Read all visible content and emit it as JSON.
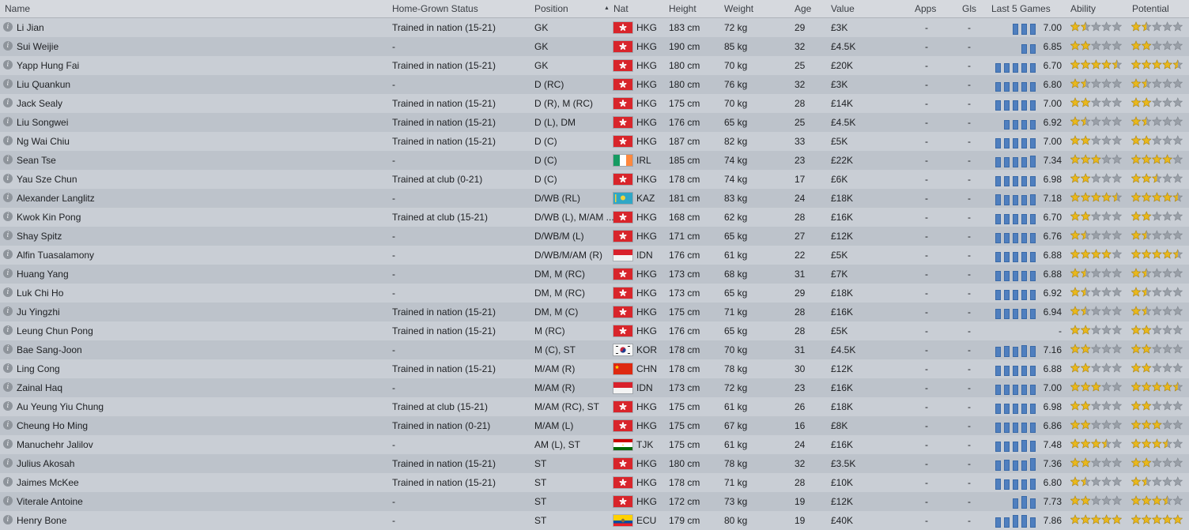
{
  "headers": {
    "name": "Name",
    "hgs": "Home-Grown Status",
    "position": "Position",
    "nat": "Nat",
    "height": "Height",
    "weight": "Weight",
    "age": "Age",
    "value": "Value",
    "apps": "Apps",
    "gls": "Gls",
    "last5": "Last 5 Games",
    "ability": "Ability",
    "potential": "Potential"
  },
  "colors": {
    "bar": "#4f7fbf",
    "star_gold": "#e9b81c",
    "star_empty": "#9aa0a8"
  },
  "players": [
    {
      "name": "Li Jian",
      "hgs": "Trained in nation (15-21)",
      "pos": "GK",
      "flag": "hkg",
      "nat": "HKG",
      "height": "183 cm",
      "weight": "72 kg",
      "age": "29",
      "value": "£3K",
      "apps": "-",
      "gls": "-",
      "last5": [
        0,
        0,
        14,
        14,
        14
      ],
      "rating": "7.00",
      "ability": 1.5,
      "potential": 1.5
    },
    {
      "name": "Sui Weijie",
      "hgs": "-",
      "pos": "GK",
      "flag": "hkg",
      "nat": "HKG",
      "height": "190 cm",
      "weight": "85 kg",
      "age": "32",
      "value": "£4.5K",
      "apps": "-",
      "gls": "-",
      "last5": [
        0,
        0,
        0,
        12,
        12
      ],
      "rating": "6.85",
      "ability": 2,
      "potential": 2
    },
    {
      "name": "Yapp Hung Fai",
      "hgs": "Trained in nation (15-21)",
      "pos": "GK",
      "flag": "hkg",
      "nat": "HKG",
      "height": "180 cm",
      "weight": "70 kg",
      "age": "25",
      "value": "£20K",
      "apps": "-",
      "gls": "-",
      "last5": [
        12,
        12,
        12,
        12,
        12
      ],
      "rating": "6.70",
      "ability": 4.5,
      "potential": 4.5
    },
    {
      "name": "Liu Quankun",
      "hgs": "-",
      "pos": "D (RC)",
      "flag": "hkg",
      "nat": "HKG",
      "height": "180 cm",
      "weight": "76 kg",
      "age": "32",
      "value": "£3K",
      "apps": "-",
      "gls": "-",
      "last5": [
        12,
        12,
        12,
        12,
        12
      ],
      "rating": "6.80",
      "ability": 1.5,
      "potential": 1.5
    },
    {
      "name": "Jack Sealy",
      "hgs": "Trained in nation (15-21)",
      "pos": "D (R), M (RC)",
      "flag": "hkg",
      "nat": "HKG",
      "height": "175 cm",
      "weight": "70 kg",
      "age": "28",
      "value": "£14K",
      "apps": "-",
      "gls": "-",
      "last5": [
        13,
        13,
        13,
        13,
        13
      ],
      "rating": "7.00",
      "ability": 2,
      "potential": 2
    },
    {
      "name": "Liu Songwei",
      "hgs": "Trained in nation (15-21)",
      "pos": "D (L), DM",
      "flag": "hkg",
      "nat": "HKG",
      "height": "176 cm",
      "weight": "65 kg",
      "age": "25",
      "value": "£4.5K",
      "apps": "-",
      "gls": "-",
      "last5": [
        0,
        12,
        12,
        12,
        12
      ],
      "rating": "6.92",
      "ability": 1.5,
      "potential": 1.5
    },
    {
      "name": "Ng Wai Chiu",
      "hgs": "Trained in nation (15-21)",
      "pos": "D (C)",
      "flag": "hkg",
      "nat": "HKG",
      "height": "187 cm",
      "weight": "82 kg",
      "age": "33",
      "value": "£5K",
      "apps": "-",
      "gls": "-",
      "last5": [
        13,
        13,
        13,
        13,
        13
      ],
      "rating": "7.00",
      "ability": 2,
      "potential": 2
    },
    {
      "name": "Sean Tse",
      "hgs": "-",
      "pos": "D (C)",
      "flag": "irl",
      "nat": "IRL",
      "height": "185 cm",
      "weight": "74 kg",
      "age": "23",
      "value": "£22K",
      "apps": "-",
      "gls": "-",
      "last5": [
        13,
        13,
        13,
        13,
        15
      ],
      "rating": "7.34",
      "ability": 3,
      "potential": 4
    },
    {
      "name": "Yau Sze Chun",
      "hgs": "Trained at club (0-21)",
      "pos": "D (C)",
      "flag": "hkg",
      "nat": "HKG",
      "height": "178 cm",
      "weight": "74 kg",
      "age": "17",
      "value": "£6K",
      "apps": "-",
      "gls": "-",
      "last5": [
        13,
        13,
        13,
        13,
        13
      ],
      "rating": "6.98",
      "ability": 2,
      "potential": 2.5
    },
    {
      "name": "Alexander Langlitz",
      "hgs": "-",
      "pos": "D/WB (RL)",
      "flag": "kaz",
      "nat": "KAZ",
      "height": "181 cm",
      "weight": "83 kg",
      "age": "24",
      "value": "£18K",
      "apps": "-",
      "gls": "-",
      "last5": [
        14,
        13,
        13,
        13,
        14
      ],
      "rating": "7.18",
      "ability": 4.5,
      "potential": 4.5
    },
    {
      "name": "Kwok Kin Pong",
      "hgs": "Trained at club (15-21)",
      "pos": "D/WB (L), M/AM ...",
      "flag": "hkg",
      "nat": "HKG",
      "height": "168 cm",
      "weight": "62 kg",
      "age": "28",
      "value": "£16K",
      "apps": "-",
      "gls": "-",
      "last5": [
        13,
        13,
        13,
        13,
        13
      ],
      "rating": "6.70",
      "ability": 2,
      "potential": 2
    },
    {
      "name": "Shay Spitz",
      "hgs": "-",
      "pos": "D/WB/M (L)",
      "flag": "hkg",
      "nat": "HKG",
      "height": "171 cm",
      "weight": "65 kg",
      "age": "27",
      "value": "£12K",
      "apps": "-",
      "gls": "-",
      "last5": [
        13,
        13,
        13,
        13,
        13
      ],
      "rating": "6.76",
      "ability": 1.5,
      "potential": 1.5
    },
    {
      "name": "Alfin Tuasalamony",
      "hgs": "-",
      "pos": "D/WB/M/AM (R)",
      "flag": "idn",
      "nat": "IDN",
      "height": "176 cm",
      "weight": "61 kg",
      "age": "22",
      "value": "£5K",
      "apps": "-",
      "gls": "-",
      "last5": [
        13,
        13,
        13,
        13,
        13
      ],
      "rating": "6.88",
      "ability": 4,
      "potential": 4.5
    },
    {
      "name": "Huang Yang",
      "hgs": "-",
      "pos": "DM, M (RC)",
      "flag": "hkg",
      "nat": "HKG",
      "height": "173 cm",
      "weight": "68 kg",
      "age": "31",
      "value": "£7K",
      "apps": "-",
      "gls": "-",
      "last5": [
        13,
        13,
        13,
        13,
        13
      ],
      "rating": "6.88",
      "ability": 1.5,
      "potential": 1.5
    },
    {
      "name": "Luk Chi Ho",
      "hgs": "-",
      "pos": "DM, M (RC)",
      "flag": "hkg",
      "nat": "HKG",
      "height": "173 cm",
      "weight": "65 kg",
      "age": "29",
      "value": "£18K",
      "apps": "-",
      "gls": "-",
      "last5": [
        13,
        13,
        13,
        13,
        13
      ],
      "rating": "6.92",
      "ability": 1.5,
      "potential": 1.5
    },
    {
      "name": "Ju Yingzhi",
      "hgs": "Trained in nation (15-21)",
      "pos": "DM, M (C)",
      "flag": "hkg",
      "nat": "HKG",
      "height": "175 cm",
      "weight": "71 kg",
      "age": "28",
      "value": "£16K",
      "apps": "-",
      "gls": "-",
      "last5": [
        13,
        13,
        13,
        13,
        13
      ],
      "rating": "6.94",
      "ability": 1.5,
      "potential": 1.5
    },
    {
      "name": "Leung Chun Pong",
      "hgs": "Trained in nation (15-21)",
      "pos": "M (RC)",
      "flag": "hkg",
      "nat": "HKG",
      "height": "176 cm",
      "weight": "65 kg",
      "age": "28",
      "value": "£5K",
      "apps": "-",
      "gls": "-",
      "last5": [
        0,
        0,
        0,
        0,
        0
      ],
      "rating": "-",
      "ability": 2,
      "potential": 2
    },
    {
      "name": "Bae Sang-Joon",
      "hgs": "-",
      "pos": "M (C), ST",
      "flag": "kor",
      "nat": "KOR",
      "height": "178 cm",
      "weight": "70 kg",
      "age": "31",
      "value": "£4.5K",
      "apps": "-",
      "gls": "-",
      "last5": [
        13,
        14,
        13,
        15,
        14
      ],
      "rating": "7.16",
      "ability": 2,
      "potential": 2
    },
    {
      "name": "Ling Cong",
      "hgs": "Trained in nation (15-21)",
      "pos": "M/AM (R)",
      "flag": "chn",
      "nat": "CHN",
      "height": "178 cm",
      "weight": "78 kg",
      "age": "30",
      "value": "£12K",
      "apps": "-",
      "gls": "-",
      "last5": [
        13,
        13,
        13,
        13,
        13
      ],
      "rating": "6.88",
      "ability": 2,
      "potential": 2
    },
    {
      "name": "Zainal Haq",
      "hgs": "-",
      "pos": "M/AM (R)",
      "flag": "idn",
      "nat": "IDN",
      "height": "173 cm",
      "weight": "72 kg",
      "age": "23",
      "value": "£16K",
      "apps": "-",
      "gls": "-",
      "last5": [
        13,
        13,
        13,
        13,
        13
      ],
      "rating": "7.00",
      "ability": 3,
      "potential": 4.5
    },
    {
      "name": "Au Yeung Yiu Chung",
      "hgs": "Trained at club (15-21)",
      "pos": "M/AM (RC), ST",
      "flag": "hkg",
      "nat": "HKG",
      "height": "175 cm",
      "weight": "61 kg",
      "age": "26",
      "value": "£18K",
      "apps": "-",
      "gls": "-",
      "last5": [
        13,
        13,
        13,
        13,
        13
      ],
      "rating": "6.98",
      "ability": 2,
      "potential": 2
    },
    {
      "name": "Cheung Ho Ming",
      "hgs": "Trained in nation (0-21)",
      "pos": "M/AM (L)",
      "flag": "hkg",
      "nat": "HKG",
      "height": "175 cm",
      "weight": "67 kg",
      "age": "16",
      "value": "£8K",
      "apps": "-",
      "gls": "-",
      "last5": [
        13,
        13,
        13,
        13,
        13
      ],
      "rating": "6.86",
      "ability": 2,
      "potential": 3
    },
    {
      "name": "Manuchehr Jalilov",
      "hgs": "-",
      "pos": "AM (L), ST",
      "flag": "tjk",
      "nat": "TJK",
      "height": "175 cm",
      "weight": "61 kg",
      "age": "24",
      "value": "£16K",
      "apps": "-",
      "gls": "-",
      "last5": [
        13,
        13,
        13,
        15,
        14
      ],
      "rating": "7.48",
      "ability": 3.5,
      "potential": 3.5
    },
    {
      "name": "Julius Akosah",
      "hgs": "Trained in nation (15-21)",
      "pos": "ST",
      "flag": "hkg",
      "nat": "HKG",
      "height": "180 cm",
      "weight": "78 kg",
      "age": "32",
      "value": "£3.5K",
      "apps": "-",
      "gls": "-",
      "last5": [
        13,
        14,
        13,
        13,
        16
      ],
      "rating": "7.36",
      "ability": 2,
      "potential": 2
    },
    {
      "name": "Jaimes McKee",
      "hgs": "Trained in nation (15-21)",
      "pos": "ST",
      "flag": "hkg",
      "nat": "HKG",
      "height": "178 cm",
      "weight": "71 kg",
      "age": "28",
      "value": "£10K",
      "apps": "-",
      "gls": "-",
      "last5": [
        14,
        13,
        13,
        13,
        14
      ],
      "rating": "6.80",
      "ability": 1.5,
      "potential": 1.5
    },
    {
      "name": "Viterale Antoine",
      "hgs": "-",
      "pos": "ST",
      "flag": "hkg",
      "nat": "HKG",
      "height": "172 cm",
      "weight": "73 kg",
      "age": "19",
      "value": "£12K",
      "apps": "-",
      "gls": "-",
      "last5": [
        0,
        0,
        13,
        16,
        13
      ],
      "rating": "7.73",
      "ability": 2,
      "potential": 3.5
    },
    {
      "name": "Henry Bone",
      "hgs": "-",
      "pos": "ST",
      "flag": "ecu",
      "nat": "ECU",
      "height": "179 cm",
      "weight": "80 kg",
      "age": "19",
      "value": "£40K",
      "apps": "-",
      "gls": "-",
      "last5": [
        13,
        13,
        16,
        16,
        13
      ],
      "rating": "7.86",
      "ability": 5,
      "potential": 5
    }
  ]
}
